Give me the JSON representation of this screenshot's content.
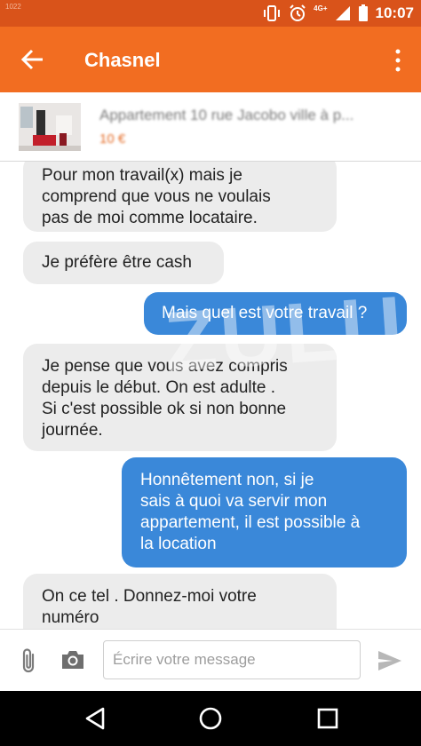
{
  "status_bar": {
    "corner_label": "1022",
    "network": "4G+",
    "time": "10:07"
  },
  "app_bar": {
    "title": "Chasnel"
  },
  "listing": {
    "title": "Appartement 10 rue Jacobo ville à p...",
    "price": "10 €"
  },
  "messages": [
    {
      "direction": "in",
      "text": "Pour mon travail(x) mais je\ncomprend que vous ne voulais\npas de moi comme locataire."
    },
    {
      "direction": "in",
      "text": "Je préfère être cash"
    },
    {
      "direction": "out",
      "text": "Mais quel est votre travail ?"
    },
    {
      "direction": "in",
      "text": "Je pense que vous avez compris\ndepuis le début. On est adulte .\nSi c'est possible ok si non bonne\njournée."
    },
    {
      "direction": "out",
      "text": "Honnêtement non, si je\nsais à quoi va servir mon\nappartement, il est possible à\nla location"
    },
    {
      "direction": "in",
      "text": "On ce tel . Donnez-moi votre\nnuméro"
    }
  ],
  "watermark": "ZULU",
  "composer": {
    "placeholder": "Écrire votre message"
  },
  "colors": {
    "status_bar": "#d9531a",
    "app_bar": "#f26d21",
    "incoming_bubble": "#ececec",
    "outgoing_bubble": "#3a88d9"
  },
  "icons": {
    "back": "arrow-left-icon",
    "menu": "more-vert-icon",
    "attach": "paperclip-icon",
    "camera": "camera-icon",
    "send": "send-icon",
    "nav_back": "triangle-back-icon",
    "nav_home": "circle-home-icon",
    "nav_recents": "square-recents-icon"
  }
}
